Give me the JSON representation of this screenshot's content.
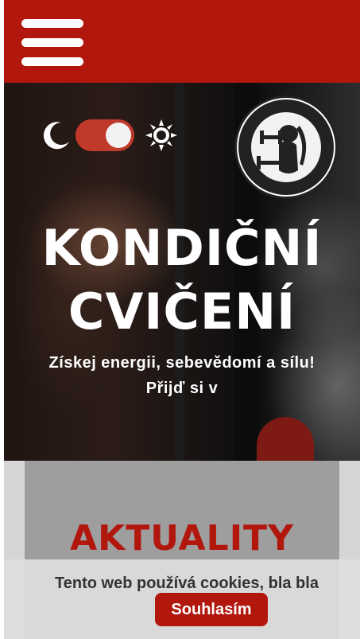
{
  "header": {
    "menu_icon": "hamburger-menu-icon",
    "brand_color": "#b2170e"
  },
  "hero": {
    "title_line1": "KONDIČNÍ",
    "title_line2": "CVIČENÍ",
    "subtitle_line1": "Získej energii, sebevědomí a sílu!",
    "subtitle_line2": "Přijď si v",
    "theme_toggle": {
      "left_icon": "moon-icon",
      "right_icon": "sun-icon",
      "state": "on"
    },
    "logo": {
      "icon": "lion-logo-icon",
      "text": "KONDIČNÍ CVIČENÍ"
    }
  },
  "news": {
    "title": "AKTUALITY"
  },
  "cookies": {
    "message": "Tento web používá cookies, bla bla bla...",
    "accept_label": "Souhlasím"
  }
}
